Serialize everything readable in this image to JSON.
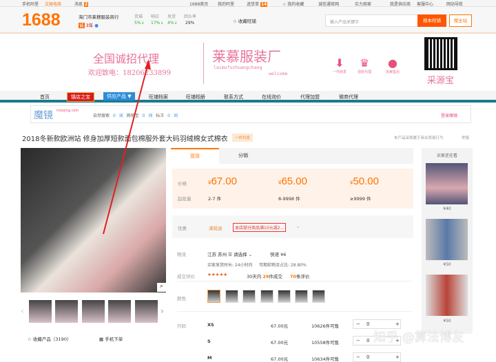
{
  "topbar": {
    "mobile": "手机阿里",
    "cultural": "文娱电商",
    "messages": "消息",
    "msg_count": "2",
    "home": "1688首页",
    "my_ali": "我的阿里",
    "purchase": "进货单",
    "purchase_count": "14",
    "fav": "我的收藏",
    "chengxin": "诚信通官网",
    "shangjia": "实力商家",
    "supplier": "我是供应商",
    "service": "客服中心",
    "sitenav": "网站导航"
  },
  "header": {
    "logo": "1688",
    "shop_name": "海门市莱穆服装商行",
    "years": "3年",
    "stats": [
      {
        "label": "货描",
        "value": "5%↓"
      },
      {
        "label": "响应",
        "value": "17%↓"
      },
      {
        "label": "发货",
        "value": "4%↓"
      },
      {
        "label": "回头率",
        "value": "29%"
      }
    ],
    "fav_shop": "收藏旺铺",
    "search_placeholder": "输入产品关键字",
    "search_shop": "搜本旺铺",
    "search_all": "搜全站"
  },
  "banner": {
    "slogan": "全国诚招代理",
    "phone": "欢迎致电：18206233899",
    "brand": "莱慕服装厂",
    "brand_pinyin": "laimufuzhuangchang",
    "welcome": "welcome",
    "features": [
      "一件转发",
      "招收代理",
      "完美售后"
    ],
    "qr_label": "采源宝"
  },
  "nav": {
    "items": [
      "首页",
      "镇店之宝",
      "供应产品 ▼",
      "旺铺档案",
      "旺铺相册",
      "联系方式",
      "在线询价",
      "代理加盟",
      "微商代理"
    ]
  },
  "mojing": {
    "logo": "魔镜",
    "domain": "moojing.com",
    "stats": [
      "自然搜索",
      "0 词",
      "网销宝",
      "0 词",
      "标王",
      "0 词"
    ],
    "login": "登录魔镜"
  },
  "product": {
    "title": "2018冬新款欧洲站 修身加厚短款面包棉服外套大码羽绒棉女式棉衣",
    "badge": "一件代发",
    "notice": "本产品采购属于商业贸易行为",
    "report": "举报",
    "collect": "收藏产品（3190）",
    "mobile_order": "手机下单"
  },
  "tabs": [
    "现货",
    "分销"
  ],
  "pricing": {
    "price_label": "价格",
    "qty_label": "起批量",
    "tiers": [
      {
        "price": "67.00",
        "qty": "2-7 件"
      },
      {
        "price": "65.00",
        "qty": "8-9998 件"
      },
      {
        "price": "50.00",
        "qty": "≥9999 件"
      }
    ],
    "currency": "¥"
  },
  "promo": {
    "label": "优惠",
    "tag": "满就送",
    "text": "本店部分商品满10元减2..."
  },
  "logistics": {
    "label": "物流",
    "from": "江苏 苏州",
    "to": "请选择",
    "express": "快递 ¥6",
    "ship_time": "买家发货时长: 24小时内",
    "ratio": "可期前物流占比: 28.80%"
  },
  "reviews": {
    "label": "成交评价",
    "rating": 4.5,
    "sold_prefix": "30天内",
    "sold": "29",
    "sold_suffix": "件成交",
    "count": "70",
    "count_suffix": "条评价"
  },
  "colors": {
    "label": "颜色"
  },
  "sizes": {
    "label": "尺码",
    "rows": [
      {
        "size": "XS",
        "price": "67.00元",
        "stock": "10626件可售",
        "qty": "0"
      },
      {
        "size": "S",
        "price": "67.00元",
        "stock": "10558件可售",
        "qty": "0"
      },
      {
        "size": "M",
        "price": "67.00元",
        "stock": "10634件可售",
        "qty": "0"
      }
    ]
  },
  "sidebar": {
    "title": "买家还在看",
    "items": [
      {
        "price": "¥40"
      },
      {
        "price": "¥50"
      },
      {
        "price": "¥50"
      }
    ]
  },
  "watermark": "知乎 @算法博友"
}
